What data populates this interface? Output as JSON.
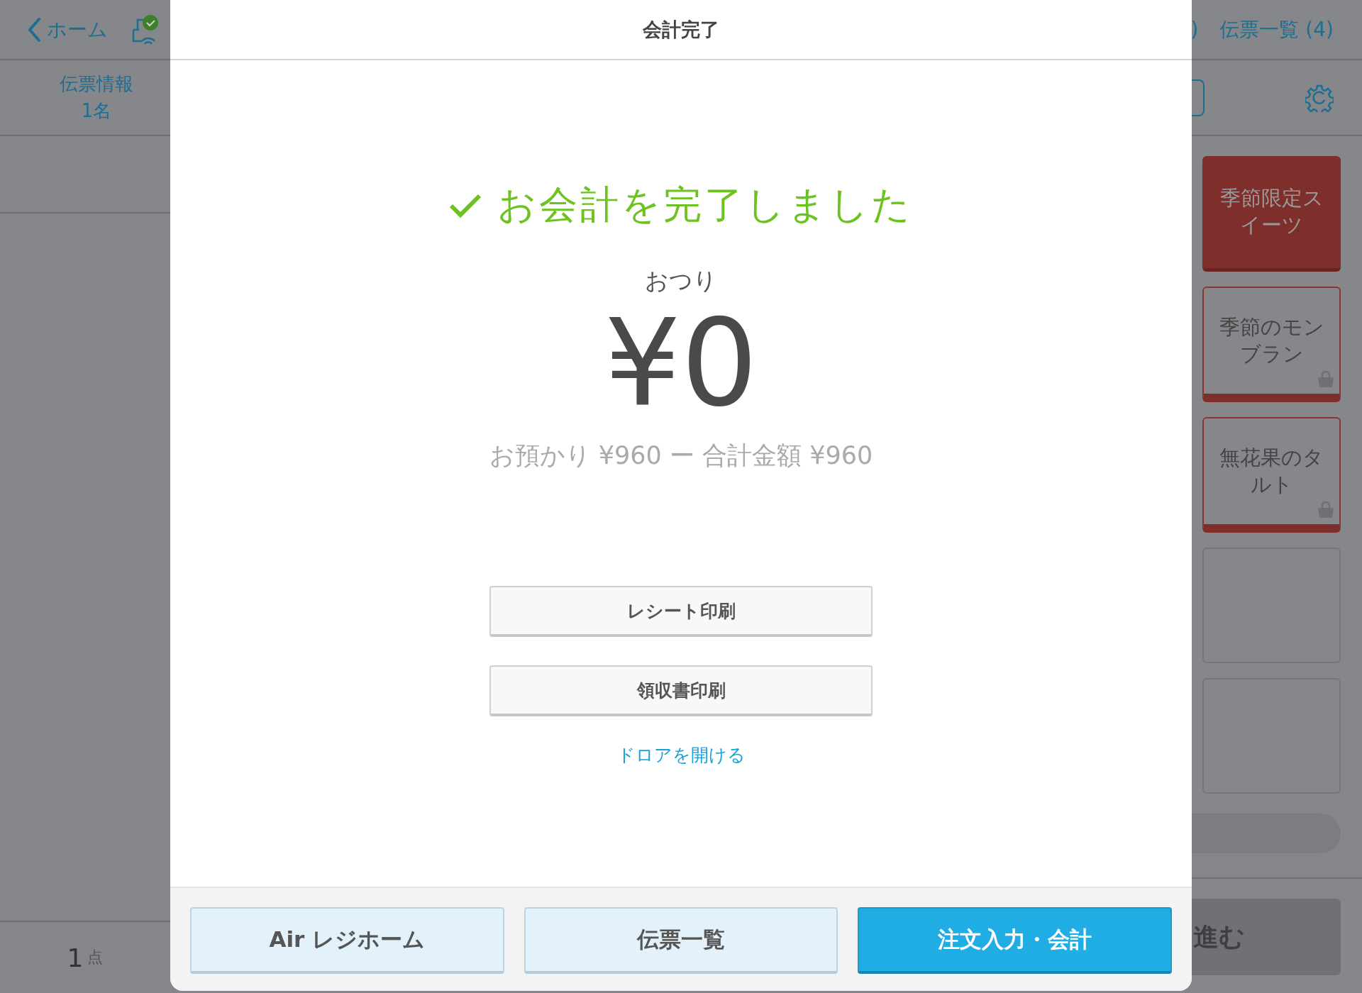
{
  "top_bar": {
    "back_label": "ホーム",
    "tab_fragment": ")",
    "slip_list_tab": "伝票一覧 (4)"
  },
  "slip_info": {
    "label": "伝票情報",
    "guests": "1名"
  },
  "item_count": {
    "number": "1",
    "unit": "点"
  },
  "menu_tiles": [
    {
      "kind": "category",
      "label": "季節限定スイーツ"
    },
    {
      "kind": "item",
      "label": "季節のモンブラン"
    },
    {
      "kind": "item",
      "label": "無花果のタルト"
    },
    {
      "kind": "empty"
    },
    {
      "kind": "empty"
    }
  ],
  "proceed_button": "進む",
  "dialog": {
    "title": "会計完了",
    "message": "お会計を完了しました",
    "change_label": "おつり",
    "change_amount": "¥0",
    "summary": "お預かり ¥960 ー 合計金額 ¥960",
    "print_buttons": [
      "レシート印刷",
      "領収書印刷"
    ],
    "drawer_link": "ドロアを開ける",
    "footer_buttons": [
      {
        "label": "Air レジホーム",
        "primary": false
      },
      {
        "label": "伝票一覧",
        "primary": false
      },
      {
        "label": "注文入力・会計",
        "primary": true
      }
    ]
  }
}
